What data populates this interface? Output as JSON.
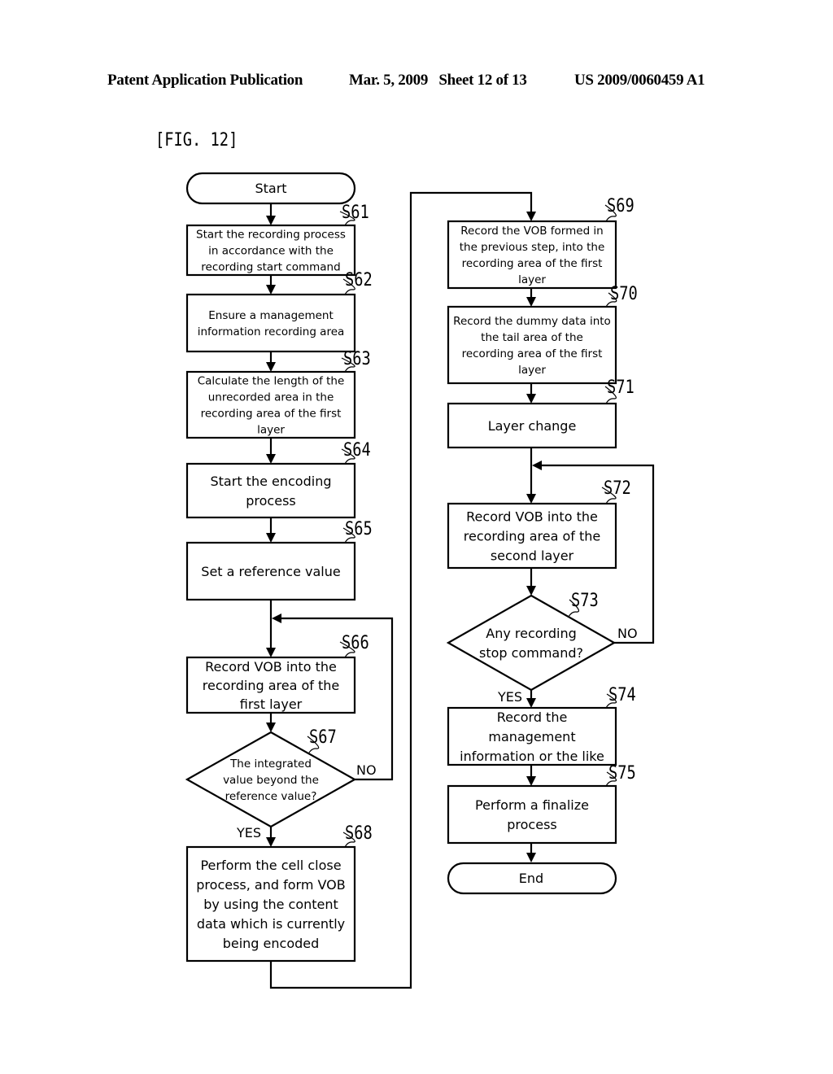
{
  "header": {
    "left": "Patent Application Publication",
    "middle": "Mar. 5, 2009   Sheet 12 of 13",
    "right": "US 2009/0060459 A1"
  },
  "figure_label": "[FIG. 12]",
  "flowchart": {
    "start": "Start",
    "end": "End",
    "steps": [
      {
        "id": "S61",
        "type": "process",
        "lines": [
          "Start the recording process",
          "in accordance with the",
          "recording start command"
        ]
      },
      {
        "id": "S62",
        "type": "process",
        "lines": [
          "Ensure a management",
          "information recording area"
        ]
      },
      {
        "id": "S63",
        "type": "process",
        "lines": [
          "Calculate the length of the",
          "unrecorded area in the",
          "recording area of the first",
          "layer"
        ]
      },
      {
        "id": "S64",
        "type": "process",
        "lines": [
          "Start the encoding",
          "process"
        ]
      },
      {
        "id": "S65",
        "type": "process",
        "lines": [
          "Set a reference value"
        ]
      },
      {
        "id": "S66",
        "type": "process",
        "lines": [
          "Record VOB into the",
          "recording area of the",
          "first layer"
        ]
      },
      {
        "id": "S67",
        "type": "decision",
        "lines": [
          "The integrated",
          "value beyond the",
          "reference value?"
        ],
        "yes": "YES",
        "no": "NO"
      },
      {
        "id": "S68",
        "type": "process",
        "lines": [
          "Perform the cell close",
          "process, and form VOB",
          "by using the content",
          "data which is currently",
          "being encoded"
        ]
      },
      {
        "id": "S69",
        "type": "process",
        "lines": [
          "Record the VOB formed in",
          "the previous step, into the",
          "recording area of the first",
          "layer"
        ]
      },
      {
        "id": "S70",
        "type": "process",
        "lines": [
          "Record the dummy data into",
          "the tail area of the",
          "recording area of the first",
          "layer"
        ]
      },
      {
        "id": "S71",
        "type": "process",
        "lines": [
          "Layer change"
        ]
      },
      {
        "id": "S72",
        "type": "process",
        "lines": [
          "Record VOB into the",
          "recording area of the",
          "second layer"
        ]
      },
      {
        "id": "S73",
        "type": "decision",
        "lines": [
          "Any recording",
          "stop command?"
        ],
        "yes": "YES",
        "no": "NO"
      },
      {
        "id": "S74",
        "type": "process",
        "lines": [
          "Record the",
          "management",
          "information or the like"
        ]
      },
      {
        "id": "S75",
        "type": "process",
        "lines": [
          "Perform a finalize",
          "process"
        ]
      }
    ]
  }
}
